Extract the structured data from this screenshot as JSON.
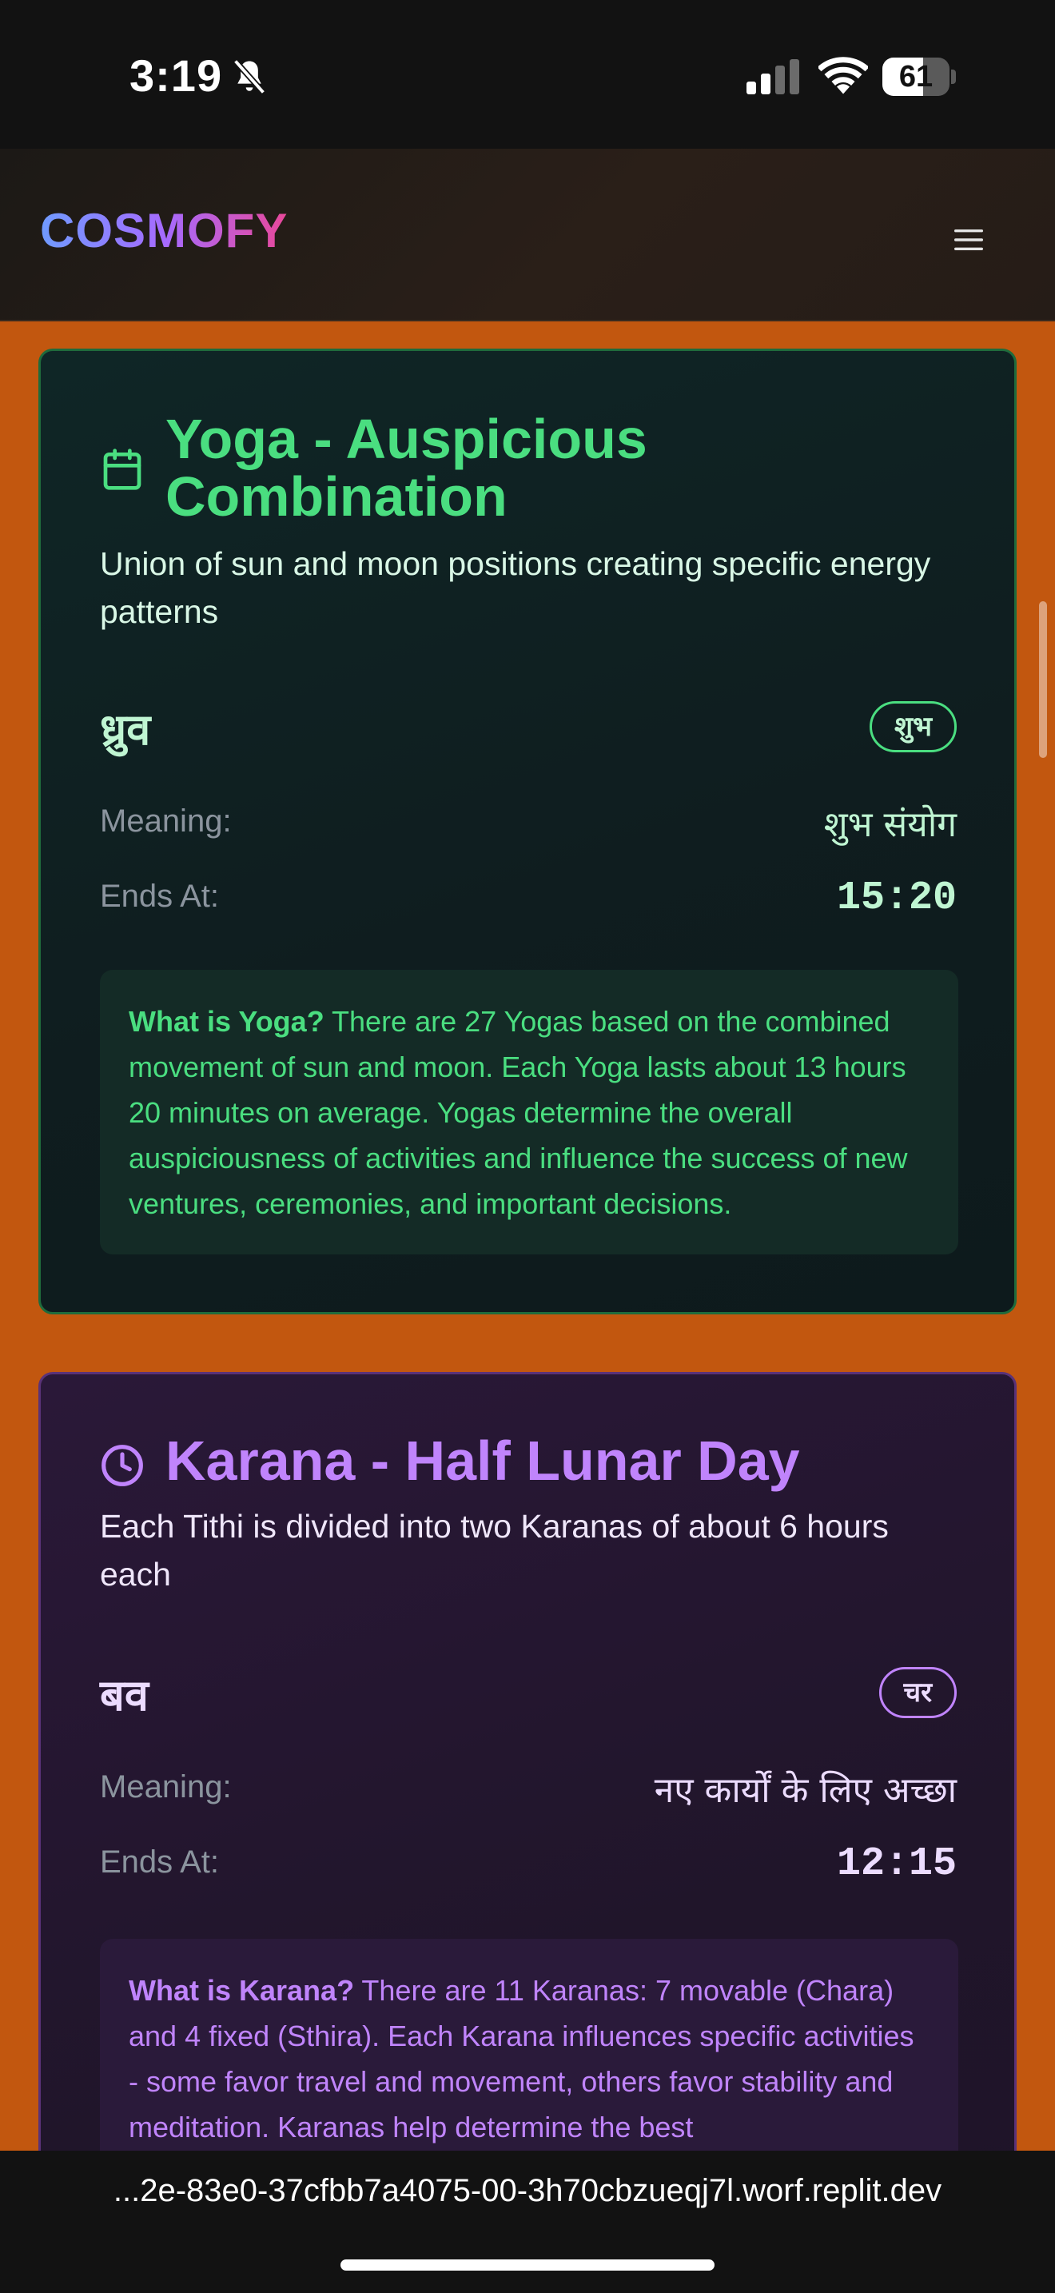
{
  "status_bar": {
    "time": "3:19",
    "battery_level": "61",
    "battery_fraction": 0.61,
    "icons": [
      "bell-slash-icon",
      "cellular-signal-icon",
      "wifi-icon",
      "battery-icon"
    ]
  },
  "header": {
    "brand": "COSMOFY",
    "menu_icon": "hamburger-menu-icon"
  },
  "yoga_card": {
    "icon": "calendar-icon",
    "title": "Yoga - Auspicious Combination",
    "subtitle": "Union of sun and moon positions creating specific energy patterns",
    "name": "ध्रुव",
    "badge": "शुभ",
    "meaning_label": "Meaning:",
    "meaning_value": "शुभ संयोग",
    "ends_label": "Ends At:",
    "ends_value": "15:20",
    "info_heading": "What is Yoga?",
    "info_text": " There are 27 Yogas based on the combined movement of sun and moon. Each Yoga lasts about 13 hours 20 minutes on average. Yogas determine the overall auspiciousness of activities and influence the success of new ventures, ceremonies, and important decisions."
  },
  "karana_card": {
    "icon": "clock-icon",
    "title": "Karana - Half Lunar Day",
    "subtitle": "Each Tithi is divided into two Karanas of about 6 hours each",
    "name": "बव",
    "badge": "चर",
    "meaning_label": "Meaning:",
    "meaning_value": "नए कार्यों के लिए अच्छा",
    "ends_label": "Ends At:",
    "ends_value": "12:15",
    "info_heading": "What is Karana?",
    "info_text": " There are 11 Karanas: 7 movable (Chara) and 4 fixed (Sthira). Each Karana influences specific activities - some favor travel and movement, others favor stability and meditation. Karanas help determine the best"
  },
  "browser": {
    "url": "...2e-83e0-37cfbb7a4075-00-3h70cbzueqj7l.worf.replit.dev"
  },
  "colors": {
    "page_background": "#c2570f",
    "yoga_accent": "#4ade80",
    "karana_accent": "#c084fc"
  }
}
